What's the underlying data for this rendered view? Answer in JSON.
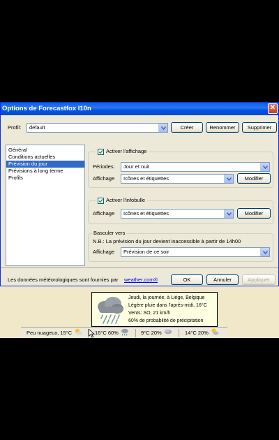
{
  "window": {
    "title": "Options de Forecastfox l10n",
    "close_glyph": "✕"
  },
  "profile": {
    "label": "Profil:",
    "value": "default",
    "create_label": "Créer",
    "rename_label": "Renommer",
    "delete_label": "Supprimer"
  },
  "tree": {
    "items": [
      {
        "label": "Général",
        "selected": false
      },
      {
        "label": "Conditions actuelles",
        "selected": false
      },
      {
        "label": "Prévision du jour",
        "selected": true
      },
      {
        "label": "Prévisions à long terme",
        "selected": false
      },
      {
        "label": "Profils",
        "selected": false
      }
    ]
  },
  "display_group": {
    "title": "Activer l'affichage",
    "checked": true,
    "periods_label": "Périodes:",
    "periods_value": "Jour et nuit",
    "display_label": "Affichage",
    "display_value": "Icônes et étiquettes",
    "modify_label": "Modifier"
  },
  "tooltip_group": {
    "title": "Activer l'infobulle",
    "checked": true,
    "display_label": "Affichage",
    "display_value": "Icônes et étiquettes",
    "modify_label": "Modifier"
  },
  "switch_group": {
    "title": "Basculer vers",
    "note": "N.B.: La prévision du jour devient inaccessible à partir de 14h00",
    "display_label": "Affichage",
    "display_value": "Prévision de ce soir"
  },
  "footer": {
    "text": "Les données météorologiques sont fournies par",
    "link": "weather.com®",
    "ok_label": "OK",
    "cancel_label": "Annuler",
    "apply_label": "Appliquer"
  },
  "weather_tooltip": {
    "line1": "Jeudi, la journée, à Liège, Belgique",
    "line2": "Légère pluie dans l'après-midi, 16°C",
    "line3": "Vents: SO, 21 km/h",
    "line4": "60% de probabilité de précipitation"
  },
  "statusbar": {
    "current": "Peu nuageux, 15°C",
    "day1": "16°C 60%",
    "day2": "9°C 20%",
    "day3": "14°C 20%"
  },
  "colors": {
    "titlebar": "#0054e3",
    "selection": "#316ac5",
    "link": "#0000ff",
    "tooltip_bg": "#ffffe1"
  }
}
